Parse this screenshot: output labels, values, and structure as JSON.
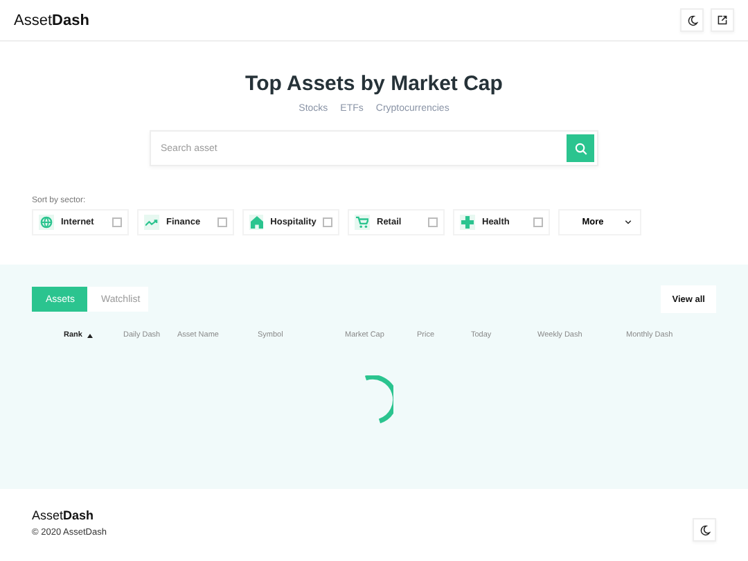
{
  "header": {
    "logo": "Asset**Dash**"
  },
  "hero": {
    "title": "Top Assets by Market Cap",
    "links": [
      "Stocks",
      "ETFs",
      "Cryptocurrencies"
    ]
  },
  "search": {
    "placeholder": "Search asset"
  },
  "sectors": {
    "label": "Sort by sector:",
    "items": [
      {
        "kind": "sector",
        "label": "Internet",
        "checked": false
      },
      {
        "kind": "sector",
        "label": "Finance",
        "checked": false
      },
      {
        "kind": "sector",
        "label": "Hospitality",
        "checked": false
      },
      {
        "kind": "sector",
        "label": "Retail",
        "checked": false
      },
      {
        "kind": "sector",
        "label": "Health",
        "checked": false
      },
      {
        "kind": "dropdown",
        "label": "More"
      }
    ]
  },
  "tabs": [
    {
      "label": "Assets",
      "selected": true
    },
    {
      "label": "Watchlist",
      "selected": false
    }
  ],
  "view_all": "View all",
  "table": {
    "columns": [
      {
        "label": "Rank",
        "sorted": true
      },
      {
        "label": "Daily Dash",
        "sorted": false
      },
      {
        "label": "Asset Name",
        "sorted": false
      },
      {
        "label": "Symbol",
        "sorted": false
      },
      {
        "label": "Market Cap",
        "sorted": false
      },
      {
        "label": "Price",
        "sorted": false
      },
      {
        "label": "Today",
        "sorted": false
      },
      {
        "label": "Weekly Dash",
        "sorted": false
      },
      {
        "label": "Monthly Dash",
        "sorted": false
      }
    ],
    "loading": true
  },
  "footer": {
    "logo": "Asset**Dash**",
    "copyright": "© 2020 AssetDash"
  }
}
